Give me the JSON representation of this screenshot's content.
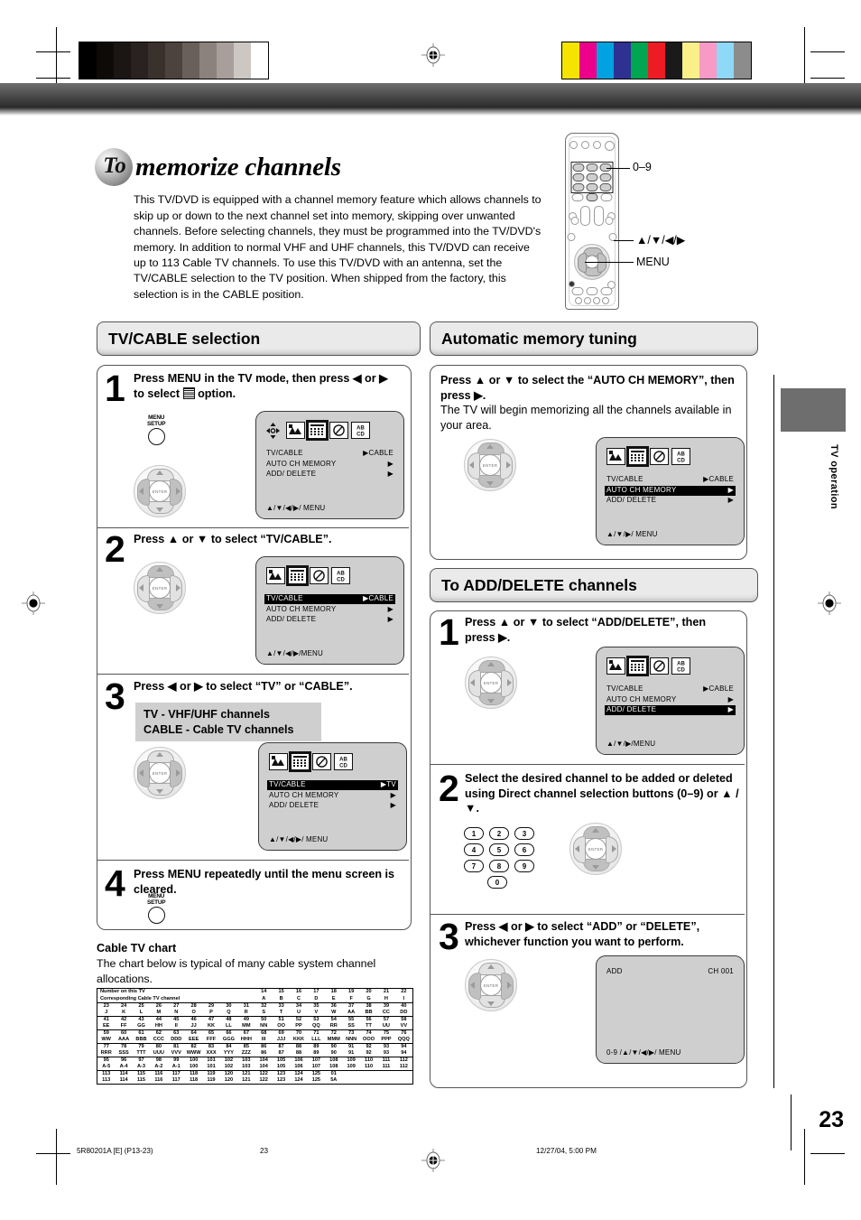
{
  "document": {
    "title_prefix": "To",
    "title_main": "memorize channels",
    "intro": "This TV/DVD is equipped with a channel memory feature which allows channels to skip up or down to the next channel set into memory, skipping over unwanted channels. Before selecting channels, they must be programmed into the TV/DVD's memory. In addition to normal VHF and UHF channels, this TV/DVD can receive up to 113 Cable TV channels. To use this TV/DVD with an antenna, set the TV/CABLE selection to the TV position. When shipped from the factory, this selection is in the CABLE position.",
    "side_tab_label": "TV operation",
    "page_number": "23"
  },
  "remote_callouts": {
    "numeric": "0–9",
    "dpad": "▲/▼/◀/▶",
    "menu": "MENU"
  },
  "sections": {
    "tv_cable": {
      "heading": "TV/CABLE selection",
      "steps": [
        {
          "number": "1",
          "text_bold": "Press MENU in the TV mode, then press ◀ or ▶ to select",
          "text_tail": "option.",
          "button_label_line1": "MENU",
          "button_label_line2": "SETUP"
        },
        {
          "number": "2",
          "text_bold": "Press ▲ or ▼ to select “TV/CABLE”."
        },
        {
          "number": "3",
          "text_bold": "Press ◀ or ▶ to select “TV” or “CABLE”.",
          "note_line1": "TV - VHF/UHF channels",
          "note_line2": "CABLE - Cable TV channels"
        },
        {
          "number": "4",
          "text_bold": "Press MENU repeatedly until the menu screen is cleared.",
          "button_label_line1": "MENU",
          "button_label_line2": "SETUP"
        }
      ]
    },
    "auto_memory": {
      "heading": "Automatic memory tuning",
      "steps": [
        {
          "text_bold": "Press ▲ or ▼ to select the “AUTO CH MEMORY”, then press ▶.",
          "text_regular": "The TV will begin memorizing all the channels available in your area."
        }
      ]
    },
    "add_delete": {
      "heading": "To ADD/DELETE channels",
      "steps": [
        {
          "number": "1",
          "text_bold": "Press ▲ or ▼ to select “ADD/DELETE”, then press ▶."
        },
        {
          "number": "2",
          "text_bold": "Select the desired channel to be added or deleted using Direct channel selection buttons (0–9) or ▲ / ▼.",
          "numeric_buttons": [
            [
              "1",
              "2",
              "3"
            ],
            [
              "4",
              "5",
              "6"
            ],
            [
              "7",
              "8",
              "9"
            ],
            [
              "0"
            ]
          ]
        },
        {
          "number": "3",
          "text_bold": "Press ◀ or ▶ to select “ADD” or “DELETE”, whichever function you want to perform."
        }
      ]
    }
  },
  "osd_screens": {
    "step1": {
      "rows": [
        {
          "label": "TV/CABLE",
          "value": "▶CABLE",
          "highlight": false
        },
        {
          "label": "AUTO  CH  MEMORY",
          "value": "▶",
          "highlight": false
        },
        {
          "label": "ADD/ DELETE",
          "value": "▶",
          "highlight": false
        }
      ],
      "footer": "▲/▼/◀/▶/ MENU",
      "show_cursor_icon": true,
      "selected_icon": 1
    },
    "step2": {
      "rows": [
        {
          "label": "TV/CABLE",
          "value": "▶CABLE",
          "highlight": true
        },
        {
          "label": "AUTO  CH  MEMORY",
          "value": "▶",
          "highlight": false
        },
        {
          "label": "ADD/ DELETE",
          "value": "▶",
          "highlight": false
        }
      ],
      "footer": "▲/▼/◀/▶/MENU",
      "show_cursor_icon": false,
      "selected_icon": 1
    },
    "step3": {
      "rows": [
        {
          "label": "TV/CABLE",
          "value": "▶TV",
          "highlight": true
        },
        {
          "label": "AUTO  CH  MEMORY",
          "value": "▶",
          "highlight": false
        },
        {
          "label": "ADD/ DELETE",
          "value": "▶",
          "highlight": false
        }
      ],
      "footer": "▲/▼/◀/▶/ MENU",
      "show_cursor_icon": false,
      "selected_icon": 1
    },
    "auto": {
      "rows": [
        {
          "label": "TV/CABLE",
          "value": "▶CABLE",
          "highlight": false
        },
        {
          "label": "AUTO  CH  MEMORY",
          "value": "▶",
          "highlight": true
        },
        {
          "label": "ADD/ DELETE",
          "value": "▶",
          "highlight": false
        }
      ],
      "footer": "▲/▼/▶/ MENU",
      "show_cursor_icon": false,
      "selected_icon": 1
    },
    "adddel": {
      "rows": [
        {
          "label": "TV/CABLE",
          "value": "▶CABLE",
          "highlight": false
        },
        {
          "label": "AUTO  CH  MEMORY",
          "value": "▶",
          "highlight": false
        },
        {
          "label": "ADD/ DELETE",
          "value": "▶",
          "highlight": true
        }
      ],
      "footer": "▲/▼/▶/MENU",
      "show_cursor_icon": false,
      "selected_icon": 1
    },
    "add_channel": {
      "left_text": "ADD",
      "right_text": "CH 001",
      "footer": "0-9 /▲/▼/◀/▶/ MENU"
    }
  },
  "cable_chart": {
    "heading": "Cable TV chart",
    "description": "The chart below is typical of many cable system channel allocations.",
    "row_label_1": "Number on this TV",
    "row_label_2": "Corresponding Cable TV channel",
    "bands": [
      {
        "tv": [
          "14",
          "15",
          "16",
          "17",
          "18",
          "19",
          "20",
          "21",
          "22"
        ],
        "cable": [
          "A",
          "B",
          "C",
          "D",
          "E",
          "F",
          "G",
          "H",
          "I"
        ],
        "offset": 9
      },
      {
        "tv": [
          "23",
          "24",
          "25",
          "26",
          "27",
          "28",
          "29",
          "30",
          "31",
          "32",
          "33",
          "34",
          "35",
          "36",
          "37",
          "38",
          "39",
          "40"
        ],
        "cable": [
          "J",
          "K",
          "L",
          "M",
          "N",
          "O",
          "P",
          "Q",
          "R",
          "S",
          "T",
          "U",
          "V",
          "W",
          "AA",
          "BB",
          "CC",
          "DD"
        ],
        "offset": 0
      },
      {
        "tv": [
          "41",
          "42",
          "43",
          "44",
          "45",
          "46",
          "47",
          "48",
          "49",
          "50",
          "51",
          "52",
          "53",
          "54",
          "55",
          "56",
          "57",
          "58"
        ],
        "cable": [
          "EE",
          "FF",
          "GG",
          "HH",
          "II",
          "JJ",
          "KK",
          "LL",
          "MM",
          "NN",
          "OO",
          "PP",
          "QQ",
          "RR",
          "SS",
          "TT",
          "UU",
          "VV"
        ],
        "offset": 0
      },
      {
        "tv": [
          "59",
          "60",
          "61",
          "62",
          "63",
          "64",
          "65",
          "66",
          "67",
          "68",
          "69",
          "70",
          "71",
          "72",
          "73",
          "74",
          "75",
          "76"
        ],
        "cable": [
          "WW",
          "AAA",
          "BBB",
          "CCC",
          "DDD",
          "EEE",
          "FFF",
          "GGG",
          "HHH",
          "III",
          "JJJ",
          "KKK",
          "LLL",
          "MMM",
          "NNN",
          "OOO",
          "PPP",
          "QQQ"
        ],
        "offset": 0
      },
      {
        "tv": [
          "77",
          "78",
          "79",
          "80",
          "81",
          "82",
          "83",
          "84",
          "85",
          "86",
          "87",
          "88",
          "89",
          "90",
          "91",
          "92",
          "93",
          "94"
        ],
        "cable": [
          "RRR",
          "SSS",
          "TTT",
          "UUU",
          "VVV",
          "WWW",
          "XXX",
          "YYY",
          "ZZZ",
          "86",
          "87",
          "88",
          "89",
          "90",
          "91",
          "92",
          "93",
          "94"
        ],
        "offset": 0
      },
      {
        "tv": [
          "95",
          "96",
          "97",
          "98",
          "99",
          "100",
          "101",
          "102",
          "103",
          "104",
          "105",
          "106",
          "107",
          "108",
          "109",
          "110",
          "111",
          "112"
        ],
        "cable": [
          "A-5",
          "A-4",
          "A-3",
          "A-2",
          "A-1",
          "100",
          "101",
          "102",
          "103",
          "104",
          "105",
          "106",
          "107",
          "108",
          "109",
          "110",
          "111",
          "112"
        ],
        "offset": 0
      },
      {
        "tv": [
          "113",
          "114",
          "115",
          "116",
          "117",
          "118",
          "119",
          "120",
          "121",
          "122",
          "123",
          "124",
          "125",
          "01"
        ],
        "cable": [
          "113",
          "114",
          "115",
          "116",
          "117",
          "118",
          "119",
          "120",
          "121",
          "122",
          "123",
          "124",
          "125",
          "5A"
        ],
        "offset": 0
      }
    ]
  },
  "footer": {
    "left": "5R80201A [E] (P13-23)",
    "center": "23",
    "right": "12/27/04, 5:00 PM"
  },
  "colorbars": {
    "gray_ramp": [
      "#000000",
      "#0d0a08",
      "#1b1513",
      "#292220",
      "#3a312d",
      "#4d433e",
      "#6b5f59",
      "#8b827d",
      "#a89f9a",
      "#cdc7c3",
      "#ffffff"
    ],
    "color_set": [
      "#f5e400",
      "#ec008c",
      "#00a3e0",
      "#2e3192",
      "#00a651",
      "#ed1c24",
      "#1a1a1a",
      "#fbef8a",
      "#f79ac6",
      "#8ed8f8",
      "#8c8c8c"
    ]
  }
}
